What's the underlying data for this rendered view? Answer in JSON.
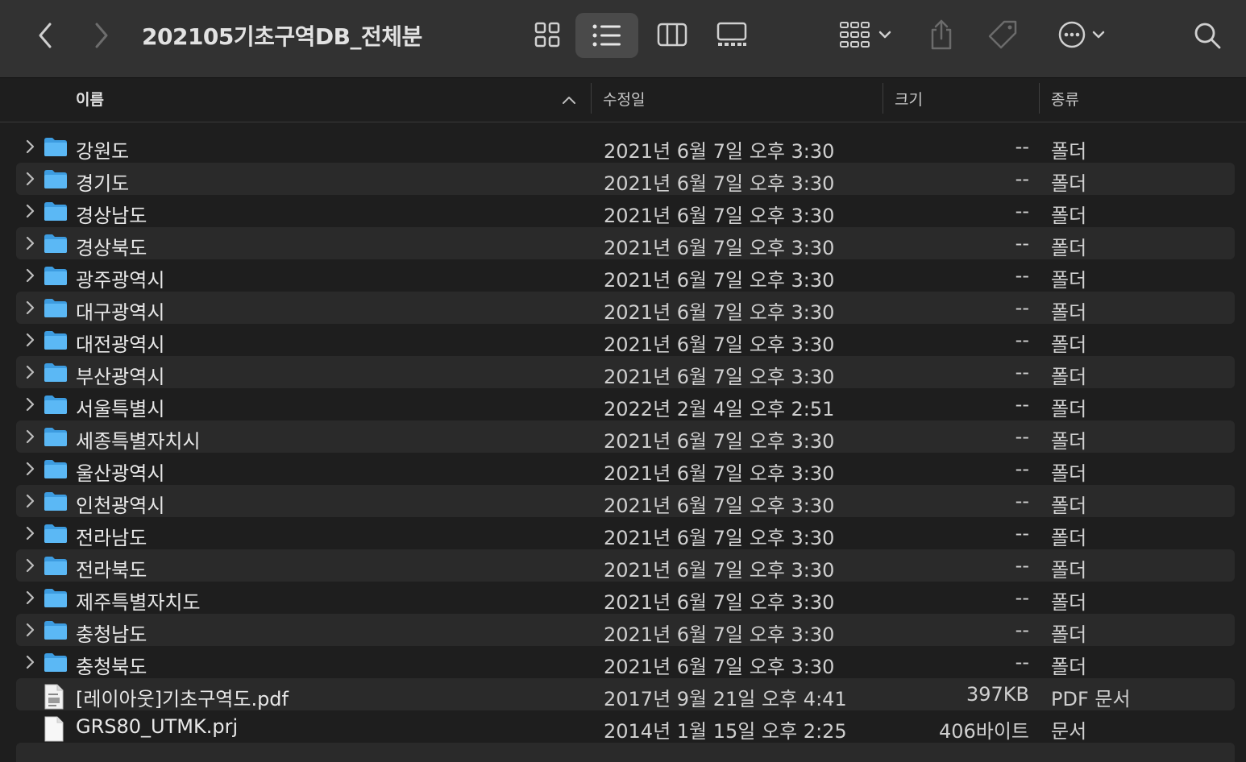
{
  "window": {
    "title": "202105기초구역DB_전체분",
    "toolbar_icons": [
      "chevron-left-icon",
      "chevron-right-icon",
      "icon-view-icon",
      "list-view-icon",
      "column-view-icon",
      "gallery-view-icon",
      "group-icon",
      "share-icon",
      "tag-icon",
      "more-icon",
      "search-icon"
    ]
  },
  "columns": {
    "name": "이름",
    "date": "수정일",
    "size": "크기",
    "kind": "종류"
  },
  "rows": [
    {
      "name": "강원도",
      "date": "2021년 6월 7일 오후 3:30",
      "size": "--",
      "kind": "폴더",
      "type": "folder"
    },
    {
      "name": "경기도",
      "date": "2021년 6월 7일 오후 3:30",
      "size": "--",
      "kind": "폴더",
      "type": "folder"
    },
    {
      "name": "경상남도",
      "date": "2021년 6월 7일 오후 3:30",
      "size": "--",
      "kind": "폴더",
      "type": "folder"
    },
    {
      "name": "경상북도",
      "date": "2021년 6월 7일 오후 3:30",
      "size": "--",
      "kind": "폴더",
      "type": "folder"
    },
    {
      "name": "광주광역시",
      "date": "2021년 6월 7일 오후 3:30",
      "size": "--",
      "kind": "폴더",
      "type": "folder"
    },
    {
      "name": "대구광역시",
      "date": "2021년 6월 7일 오후 3:30",
      "size": "--",
      "kind": "폴더",
      "type": "folder"
    },
    {
      "name": "대전광역시",
      "date": "2021년 6월 7일 오후 3:30",
      "size": "--",
      "kind": "폴더",
      "type": "folder"
    },
    {
      "name": "부산광역시",
      "date": "2021년 6월 7일 오후 3:30",
      "size": "--",
      "kind": "폴더",
      "type": "folder"
    },
    {
      "name": "서울특별시",
      "date": "2022년 2월 4일 오후 2:51",
      "size": "--",
      "kind": "폴더",
      "type": "folder"
    },
    {
      "name": "세종특별자치시",
      "date": "2021년 6월 7일 오후 3:30",
      "size": "--",
      "kind": "폴더",
      "type": "folder"
    },
    {
      "name": "울산광역시",
      "date": "2021년 6월 7일 오후 3:30",
      "size": "--",
      "kind": "폴더",
      "type": "folder"
    },
    {
      "name": "인천광역시",
      "date": "2021년 6월 7일 오후 3:30",
      "size": "--",
      "kind": "폴더",
      "type": "folder"
    },
    {
      "name": "전라남도",
      "date": "2021년 6월 7일 오후 3:30",
      "size": "--",
      "kind": "폴더",
      "type": "folder"
    },
    {
      "name": "전라북도",
      "date": "2021년 6월 7일 오후 3:30",
      "size": "--",
      "kind": "폴더",
      "type": "folder"
    },
    {
      "name": "제주특별자치도",
      "date": "2021년 6월 7일 오후 3:30",
      "size": "--",
      "kind": "폴더",
      "type": "folder"
    },
    {
      "name": "충청남도",
      "date": "2021년 6월 7일 오후 3:30",
      "size": "--",
      "kind": "폴더",
      "type": "folder"
    },
    {
      "name": "충청북도",
      "date": "2021년 6월 7일 오후 3:30",
      "size": "--",
      "kind": "폴더",
      "type": "folder"
    },
    {
      "name": "[레이아웃]기초구역도.pdf",
      "date": "2017년 9월 21일 오후 4:41",
      "size": "397KB",
      "kind": "PDF 문서",
      "type": "pdf"
    },
    {
      "name": "GRS80_UTMK.prj",
      "date": "2014년 1월 15일 오후 2:25",
      "size": "406바이트",
      "kind": "문서",
      "type": "doc"
    }
  ],
  "colors": {
    "folder": "#5bb8f5",
    "folder_tab": "#3d9ce0",
    "row_alt": "#2a2a2a",
    "toolbar": "#323232"
  }
}
